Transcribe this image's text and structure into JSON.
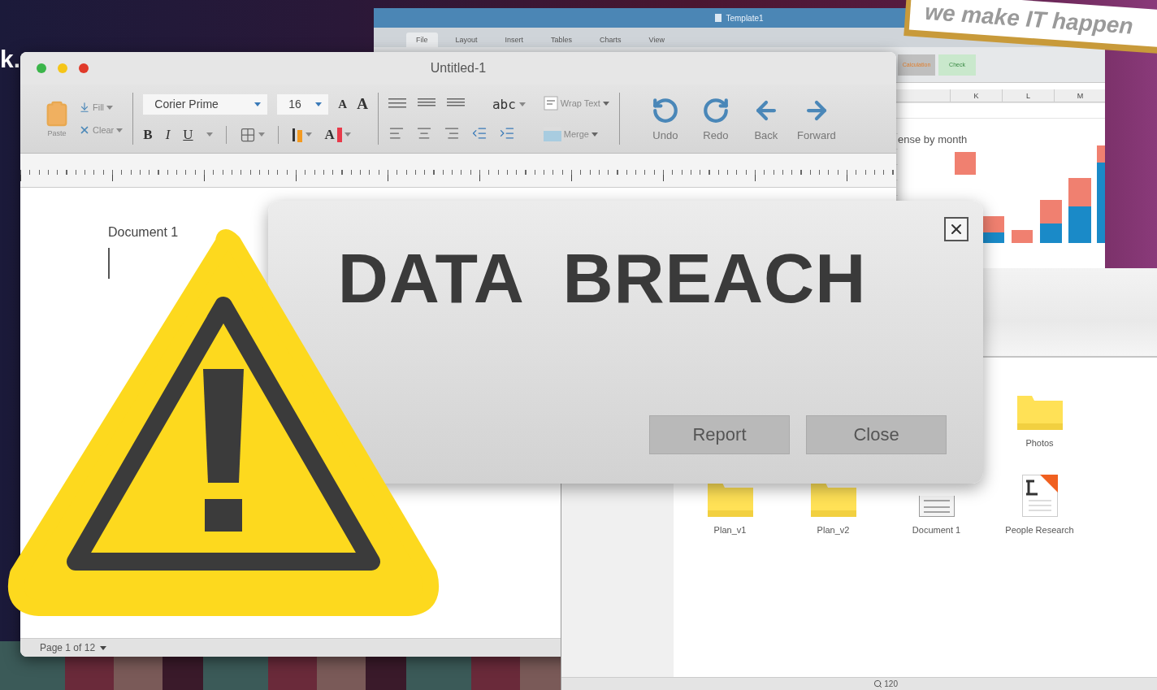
{
  "edge_text": "k.",
  "banner": {
    "text": "we make IT happen"
  },
  "spreadsheet": {
    "title": "Template1",
    "tabs": [
      {
        "label": "File",
        "selected": true
      },
      {
        "label": "Layout",
        "selected": false
      },
      {
        "label": "Insert",
        "selected": false
      },
      {
        "label": "Tables",
        "selected": false
      },
      {
        "label": "Charts",
        "selected": false
      },
      {
        "label": "View",
        "selected": false
      }
    ],
    "styles": [
      {
        "label": "Calculation",
        "kind": "calculation"
      },
      {
        "label": "Check",
        "kind": "check"
      }
    ],
    "columns": [
      "K",
      "L",
      "M"
    ],
    "chart_title": "ense by month"
  },
  "files": {
    "items": [
      {
        "name": "Photos",
        "kind": "folder"
      },
      {
        "name": "Plan_v1",
        "kind": "folder"
      },
      {
        "name": "Plan_v2",
        "kind": "folder"
      },
      {
        "name": "Document 1",
        "kind": "document"
      },
      {
        "name": "People Research",
        "kind": "letter"
      }
    ],
    "zoom": "120"
  },
  "editor": {
    "title": "Untitled-1",
    "paste": "Paste",
    "fill": "Fill",
    "clear": "Clear",
    "font": "Corier Prime",
    "size": "16",
    "size_buttons": [
      "A",
      "A"
    ],
    "format_buttons": [
      "B",
      "I",
      "U"
    ],
    "font_color": "A",
    "style_sample": "abc",
    "wrap": "Wrap Text",
    "merge": "Merge",
    "actions": [
      {
        "label": "Undo",
        "kind": "undo"
      },
      {
        "label": "Redo",
        "kind": "redo"
      },
      {
        "label": "Back",
        "kind": "back"
      },
      {
        "label": "Forward",
        "kind": "forward"
      }
    ],
    "doc_heading": "Document 1",
    "page": "Page 1 of 12"
  },
  "dialog": {
    "title": "DATA  BREACH",
    "buttons": [
      "Report",
      "Close"
    ]
  }
}
